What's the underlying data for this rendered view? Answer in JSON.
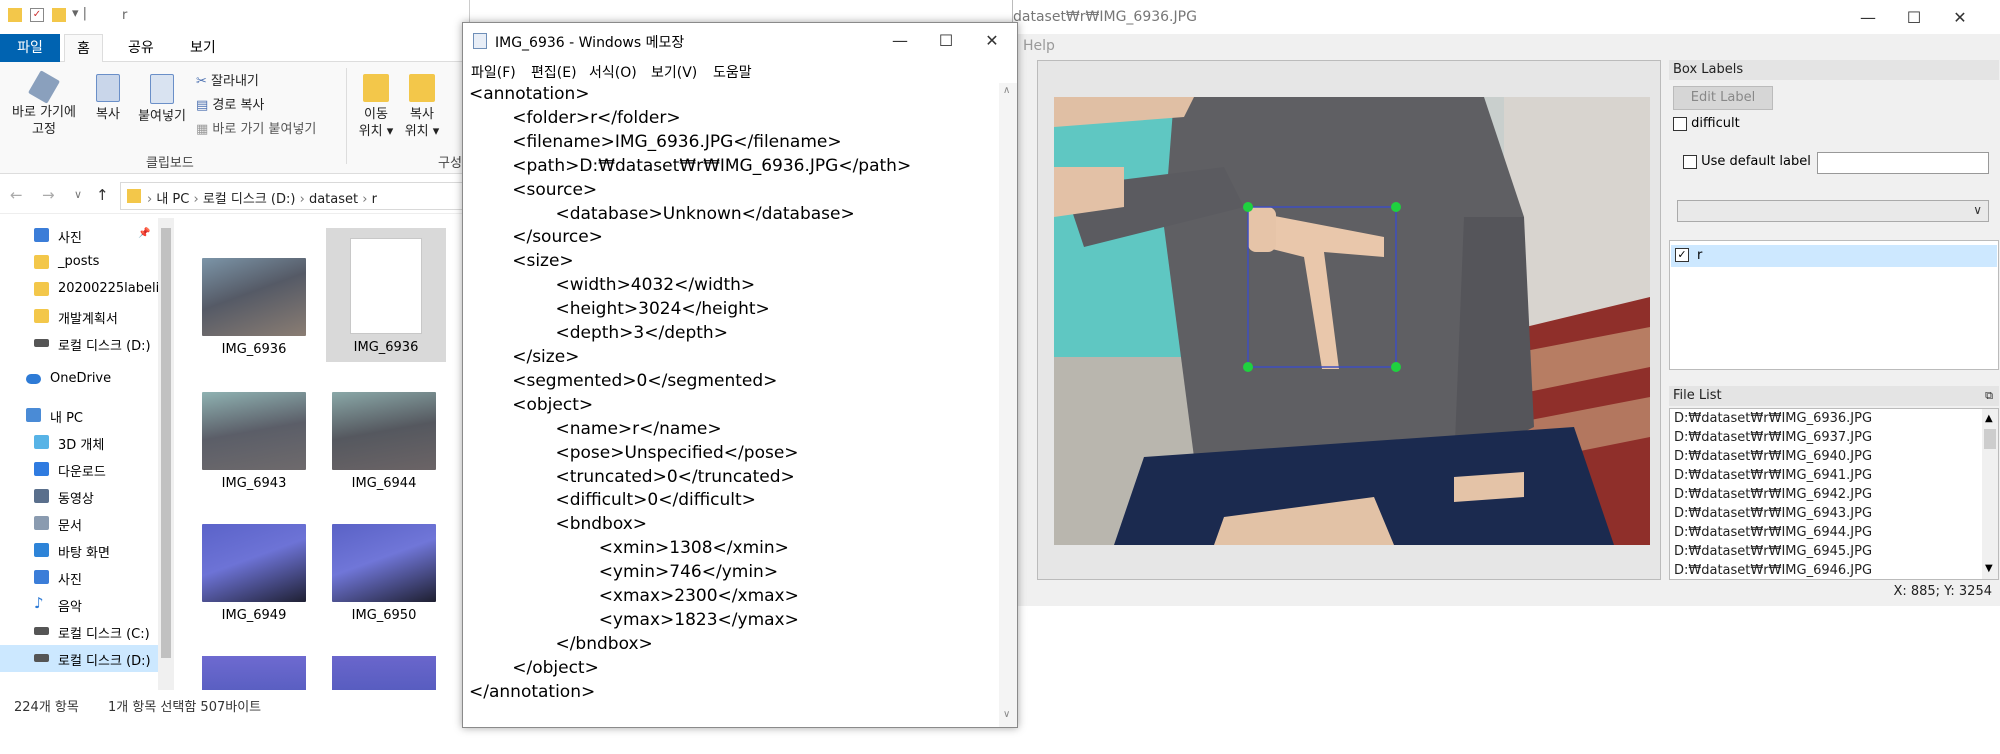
{
  "explorer": {
    "title_path": "r",
    "tabs": [
      "파일",
      "홈",
      "공유",
      "보기"
    ],
    "ribbon": {
      "pin_label": "바로 가기에\n고정",
      "copy_label": "복사",
      "paste_label": "붙여넣기",
      "cut_label": "잘라내기",
      "copy_path_label": "경로 복사",
      "paste_shortcut_label": "바로 가기 붙여넣기",
      "clipboard_group": "클립보드",
      "move_label": "이동\n위치 ▾",
      "copyto_label": "복사\n위치 ▾",
      "organize_group": "구성"
    },
    "breadcrumb": [
      "내 PC",
      "로컬 디스크 (D:)",
      "dataset",
      "r"
    ],
    "nav_items": [
      "사진",
      "_posts",
      "20200225labeli",
      "개발계획서",
      "로컬 디스크 (D:)",
      "OneDrive",
      "내 PC",
      "3D 개체",
      "다운로드",
      "동영상",
      "문서",
      "바탕 화면",
      "사진",
      "음악",
      "로컬 디스크 (C:)",
      "로컬 디스크 (D:)"
    ],
    "thumbnails": [
      "IMG_6936",
      "IMG_6936",
      "IMG_6943",
      "IMG_6944",
      "IMG_6949",
      "IMG_6950"
    ],
    "status_count": "224개 항목",
    "status_selected": "1개 항목 선택함 507바이트"
  },
  "notepad": {
    "title": "IMG_6936 - Windows 메모장",
    "menu": [
      "파일(F)",
      "편집(E)",
      "서식(O)",
      "보기(V)",
      "도움말"
    ],
    "lines": [
      "<annotation>",
      "\t<folder>r</folder>",
      "\t<filename>IMG_6936.JPG</filename>",
      "\t<path>D:₩dataset₩r₩IMG_6936.JPG</path>",
      "\t<source>",
      "\t\t<database>Unknown</database>",
      "\t</source>",
      "\t<size>",
      "\t\t<width>4032</width>",
      "\t\t<height>3024</height>",
      "\t\t<depth>3</depth>",
      "\t</size>",
      "\t<segmented>0</segmented>",
      "\t<object>",
      "\t\t<name>r</name>",
      "\t\t<pose>Unspecified</pose>",
      "\t\t<truncated>0</truncated>",
      "\t\t<difficult>0</difficult>",
      "\t\t<bndbox>",
      "\t\t\t<xmin>1308</xmin>",
      "\t\t\t<ymin>746</ymin>",
      "\t\t\t<xmax>2300</xmax>",
      "\t\t\t<ymax>1823</ymax>",
      "\t\t</bndbox>",
      "\t</object>",
      "</annotation>"
    ]
  },
  "labelimg": {
    "title": "dataset₩r₩IMG_6936.JPG",
    "menu_help": "Help",
    "box_labels_header": "Box Labels",
    "edit_label_button": "Edit Label",
    "difficult_label": "difficult",
    "use_default_label": "Use default label",
    "default_label_value": "",
    "label_item": "r",
    "file_list_header": "File List",
    "files": [
      "D:₩dataset₩r₩IMG_6936.JPG",
      "D:₩dataset₩r₩IMG_6937.JPG",
      "D:₩dataset₩r₩IMG_6940.JPG",
      "D:₩dataset₩r₩IMG_6941.JPG",
      "D:₩dataset₩r₩IMG_6942.JPG",
      "D:₩dataset₩r₩IMG_6943.JPG",
      "D:₩dataset₩r₩IMG_6944.JPG",
      "D:₩dataset₩r₩IMG_6945.JPG",
      "D:₩dataset₩r₩IMG_6946.JPG"
    ],
    "coords": "X: 885; Y: 3254"
  },
  "colors": {
    "accent": "#0078d7",
    "selected_label": "#cde8ff",
    "bbox_stroke": "#3f4fc0",
    "bbox_handle": "#1fd13f",
    "sweater": "#5f5f63"
  }
}
